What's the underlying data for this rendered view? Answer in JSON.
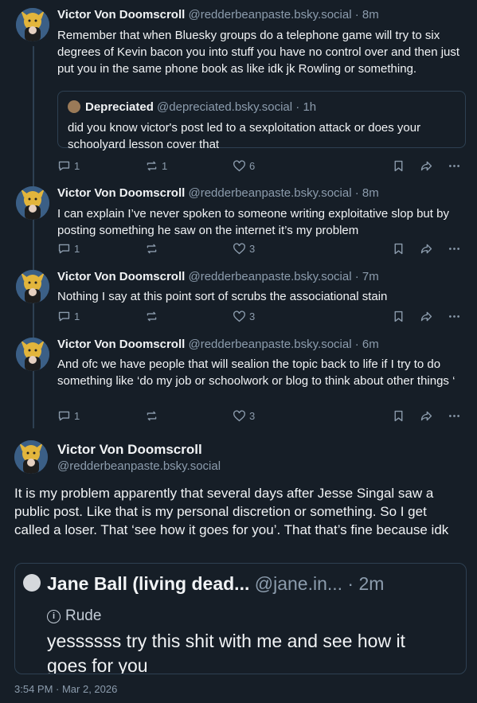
{
  "posts": [
    {
      "author": "Victor Von Doomscroll",
      "handle": "@redderbeanpaste.bsky.social",
      "time": "8m",
      "text": "Remember that when Bluesky groups do a telephone game will try to six degrees of Kevin bacon you into stuff you have no control over and then just put you in the same phone book as like idk jk Rowling or something.",
      "quote": {
        "author": "Depreciated",
        "handle": "@depreciated.bsky.social",
        "time": "1h",
        "text": "did you know victor's post led to a sexploitation attack or does your schoolyard lesson cover that"
      },
      "replies": "1",
      "reposts": "1",
      "likes": "6"
    },
    {
      "author": "Victor Von Doomscroll",
      "handle": "@redderbeanpaste.bsky.social",
      "time": "8m",
      "text": "I can explain I’ve never spoken to someone writing exploitative slop but by posting something he saw on the internet it’s my problem",
      "replies": "1",
      "reposts": "",
      "likes": "3"
    },
    {
      "author": "Victor Von Doomscroll",
      "handle": "@redderbeanpaste.bsky.social",
      "time": "7m",
      "text": "Nothing I say at this point sort of scrubs the associational stain",
      "replies": "1",
      "reposts": "",
      "likes": "3"
    },
    {
      "author": "Victor Von Doomscroll",
      "handle": "@redderbeanpaste.bsky.social",
      "time": "6m",
      "text": "And ofc we have people that will sealion the topic back to life if I try to do something like ‘do my job or schoolwork or blog to think about other things ‘",
      "replies": "1",
      "reposts": "",
      "likes": "3"
    }
  ],
  "main_post": {
    "author": "Victor Von Doomscroll",
    "handle": "@redderbeanpaste.bsky.social",
    "text": "It is my problem apparently that several days after Jesse Singal saw a public post. Like that is my personal discretion or something. So I get called a loser. That ‘see how it goes for you’. That that’s fine because idk",
    "quote": {
      "author": "Jane Ball (living dead...",
      "handle": "@jane.in...",
      "time": "2m",
      "label": "Rude",
      "text": "yessssss try this shit with me and see how it goes for you"
    },
    "timestamp": "3:54 PM · Mar 2, 2026"
  },
  "colors": {
    "background": "#161e27",
    "text": "#f1f3f5",
    "muted": "#8c9cad",
    "border": "#2e4052"
  },
  "icons": [
    "reply-icon",
    "repost-icon",
    "like-icon",
    "bookmark-icon",
    "share-icon",
    "more-icon",
    "info-icon"
  ]
}
